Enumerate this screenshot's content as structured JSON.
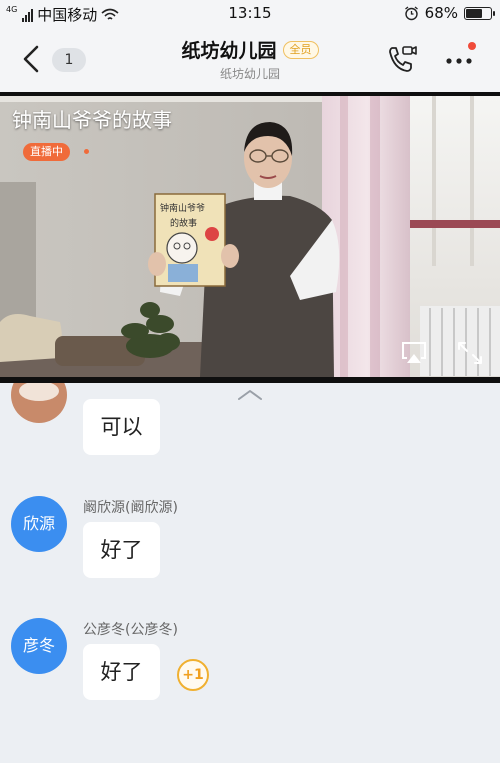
{
  "status_bar": {
    "network_type": "4G",
    "carrier": "中国移动",
    "time": "13:15",
    "battery": "68%",
    "battery_level": 0.68
  },
  "header": {
    "unread_count": "1",
    "title": "纸坊幼儿园",
    "member_tag": "全员",
    "subtitle": "纸坊幼儿园"
  },
  "live": {
    "title": "钟南山爷爷的故事",
    "badge": "直播中",
    "book_title": "钟南山爷爷的故事"
  },
  "messages": [
    {
      "sender": "",
      "avatar_text": "",
      "text": "可以"
    },
    {
      "sender": "阚欣源(阚欣源)",
      "avatar_text": "欣源",
      "text": "好了"
    },
    {
      "sender": "公彦冬(公彦冬)",
      "avatar_text": "彦冬",
      "text": "好了",
      "reaction": "+1"
    }
  ],
  "colors": {
    "accent_blue": "#3b8ef0",
    "live_orange": "#f06b3a",
    "notification_red": "#f04b3a",
    "member_gold": "#e0a020",
    "chat_background": "#eceff3"
  },
  "icons": {
    "back": "chevron-left-icon",
    "call": "video-call-icon",
    "more": "more-dots-icon",
    "airplay": "airplay-icon",
    "fullscreen": "fullscreen-icon",
    "collapse": "chevron-up-icon"
  }
}
